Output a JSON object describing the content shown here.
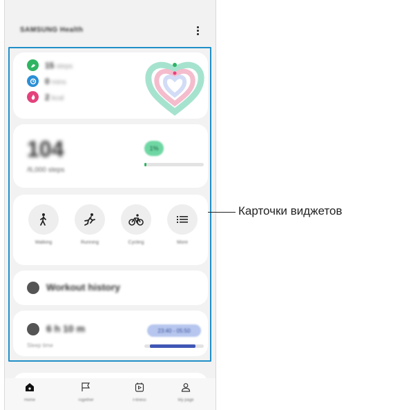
{
  "header": {
    "app_title": "SAMSUNG Health"
  },
  "activity_summary": {
    "rows": [
      {
        "icon": "shoe-icon",
        "color": "#2fb463",
        "value": "15",
        "unit": "steps"
      },
      {
        "icon": "clock-icon",
        "color": "#2b8fd6",
        "value": "0",
        "unit": "mins"
      },
      {
        "icon": "flame-icon",
        "color": "#e4427d",
        "value": "2",
        "unit": "kcal"
      }
    ],
    "rings_colors": [
      "#8fd9c0",
      "#f3b8c9",
      "#cdd9f6"
    ]
  },
  "steps_card": {
    "count": "104",
    "goal": "/6,000 steps",
    "percent_label": "1%",
    "progress": 0.02,
    "accent": "#2fb463"
  },
  "exercise_card": {
    "items": [
      {
        "label": "Walking",
        "icon": "walking-icon"
      },
      {
        "label": "Running",
        "icon": "running-icon"
      },
      {
        "label": "Cycling",
        "icon": "cycling-icon"
      },
      {
        "label": "More",
        "icon": "list-icon"
      }
    ]
  },
  "workout_card": {
    "label": "Workout history",
    "icon": "timer-icon"
  },
  "sleep_card": {
    "duration": "6 h 10 m",
    "label": "Sleep time",
    "range": "23:40 - 05:50",
    "accent": "#3f57b5"
  },
  "nav": {
    "items": [
      {
        "label": "Home",
        "icon": "home-icon"
      },
      {
        "label": "Together",
        "icon": "flag-icon"
      },
      {
        "label": "Fitness",
        "icon": "fitness-icon"
      },
      {
        "label": "My page",
        "icon": "person-icon"
      }
    ]
  },
  "annotation": {
    "text": "Карточки виджетов"
  },
  "colors": {
    "highlight": "#1f8fc8"
  }
}
